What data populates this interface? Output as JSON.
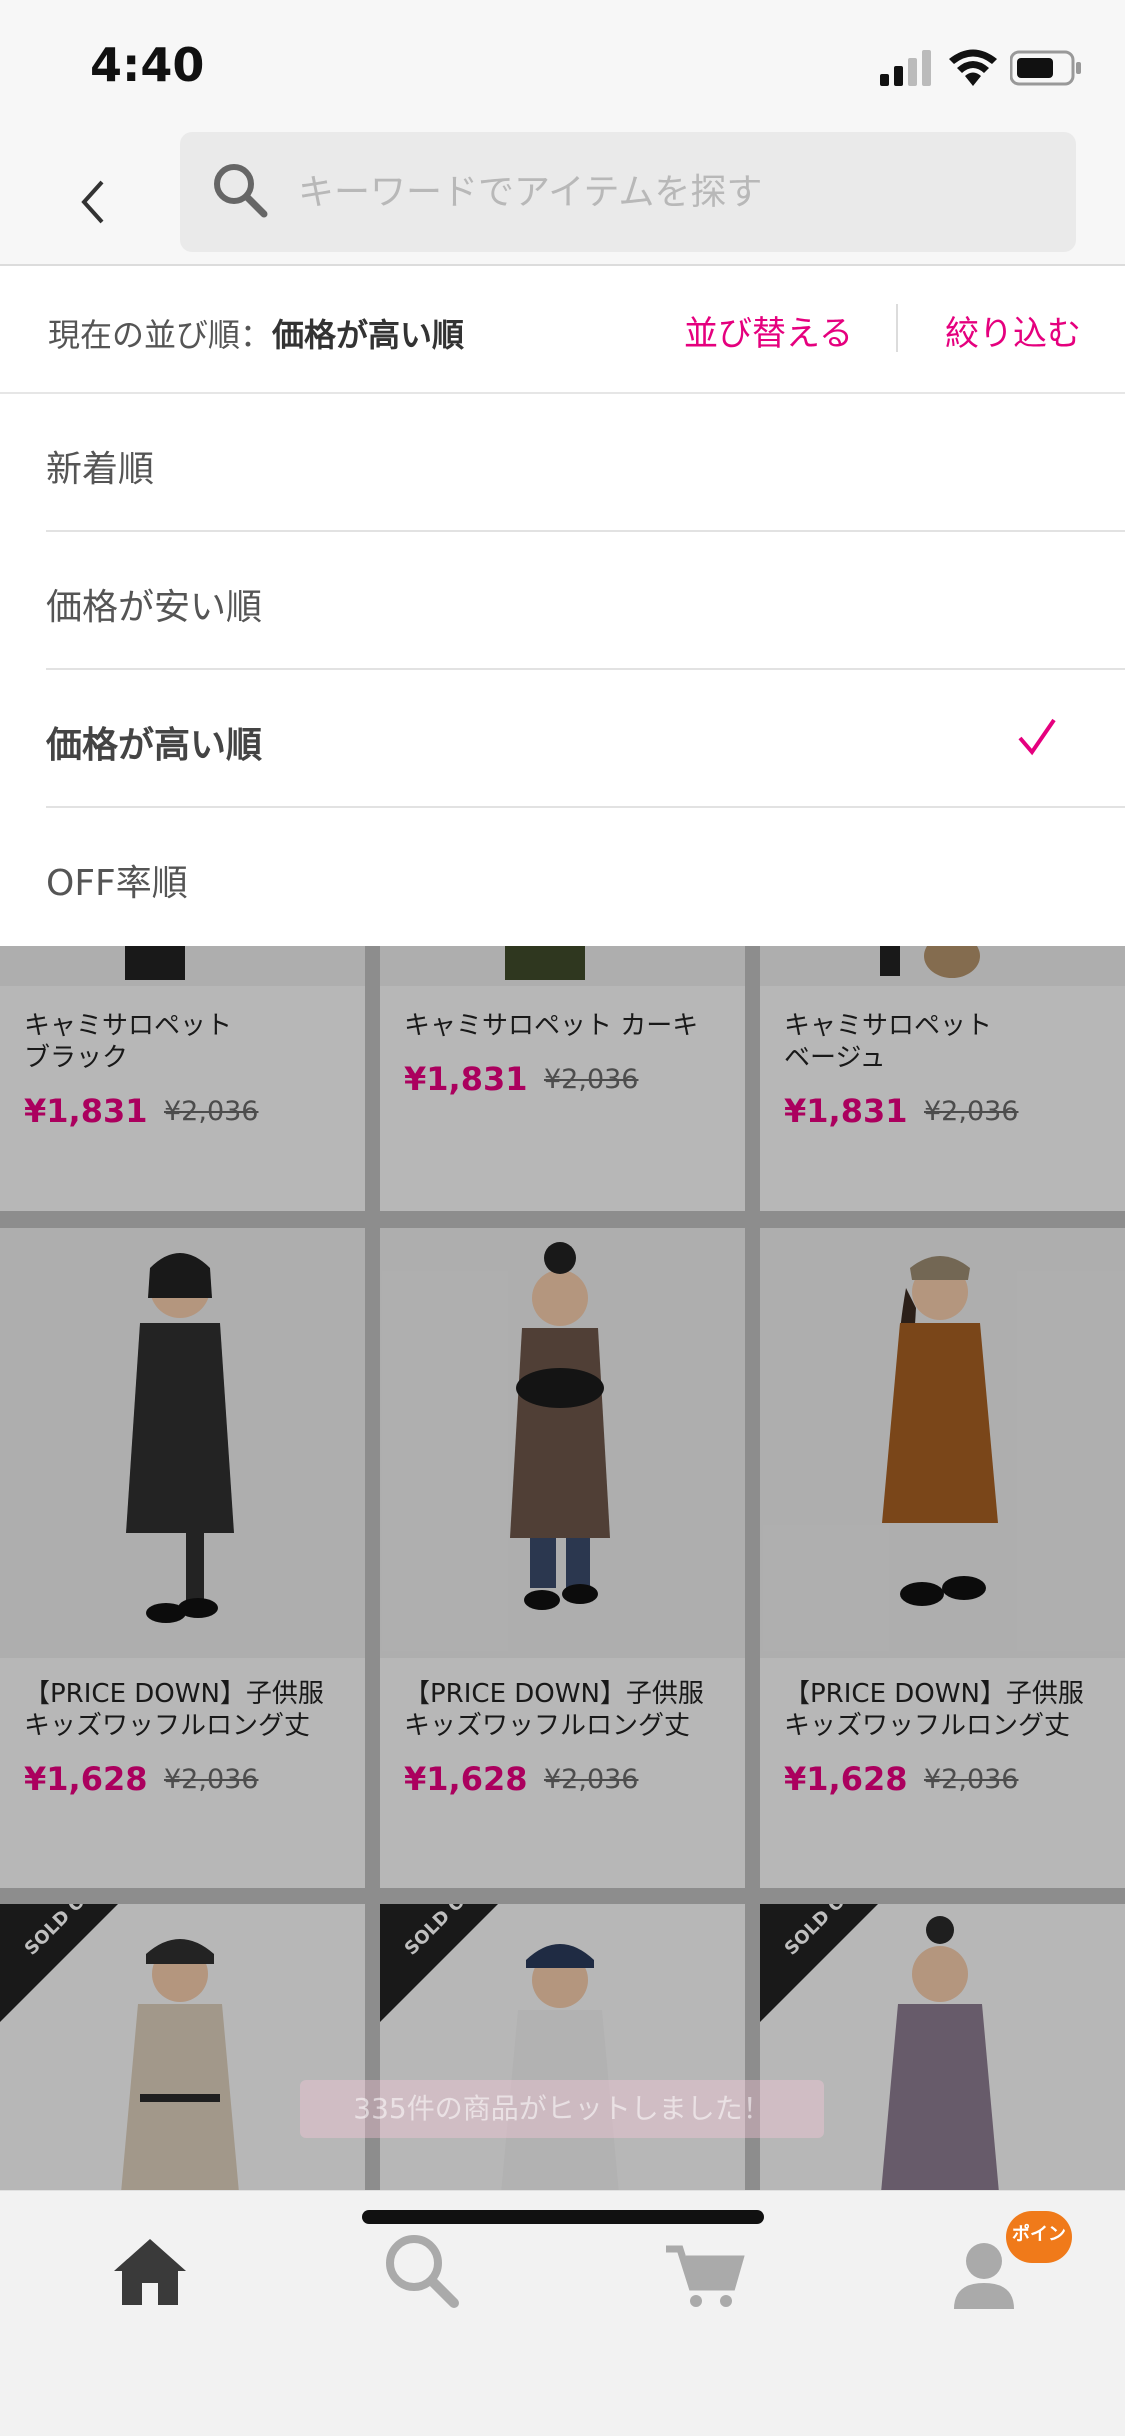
{
  "status_bar": {
    "time": "4:40"
  },
  "header": {
    "search_placeholder": "キーワードでアイテムを探す"
  },
  "sort_bar": {
    "current_prefix": "現在の並び順：",
    "current_value": "価格が高い順",
    "sort_label": "並び替える",
    "filter_label": "絞り込む"
  },
  "sort_menu": {
    "options": [
      "新着順",
      "価格が安い順",
      "価格が高い順",
      "OFF率順"
    ],
    "selected": "価格が高い順"
  },
  "products": [
    {
      "name": "キャミサロペット\nブラック",
      "price": "¥1,831",
      "orig": "¥2,036"
    },
    {
      "name": "キャミサロペット カーキ",
      "price": "¥1,831",
      "orig": "¥2,036"
    },
    {
      "name": "キャミサロペット\nベージュ",
      "price": "¥1,831",
      "orig": "¥2,036"
    },
    {
      "name": "【PRICE DOWN】子供服\nキッズワッフルロング丈",
      "price": "¥1,628",
      "orig": "¥2,036"
    },
    {
      "name": "【PRICE DOWN】子供服\nキッズワッフルロング丈",
      "price": "¥1,628",
      "orig": "¥2,036"
    },
    {
      "name": "【PRICE DOWN】子供服\nキッズワッフルロング丈",
      "price": "¥1,628",
      "orig": "¥2,036"
    }
  ],
  "sold_out_label": "SOLD OUT",
  "toast": "335件の商品がヒットしました！",
  "tab_bar": {
    "badge": "ポイン"
  },
  "colors": {
    "accent": "#e5007e",
    "badge": "#f07a1a"
  }
}
